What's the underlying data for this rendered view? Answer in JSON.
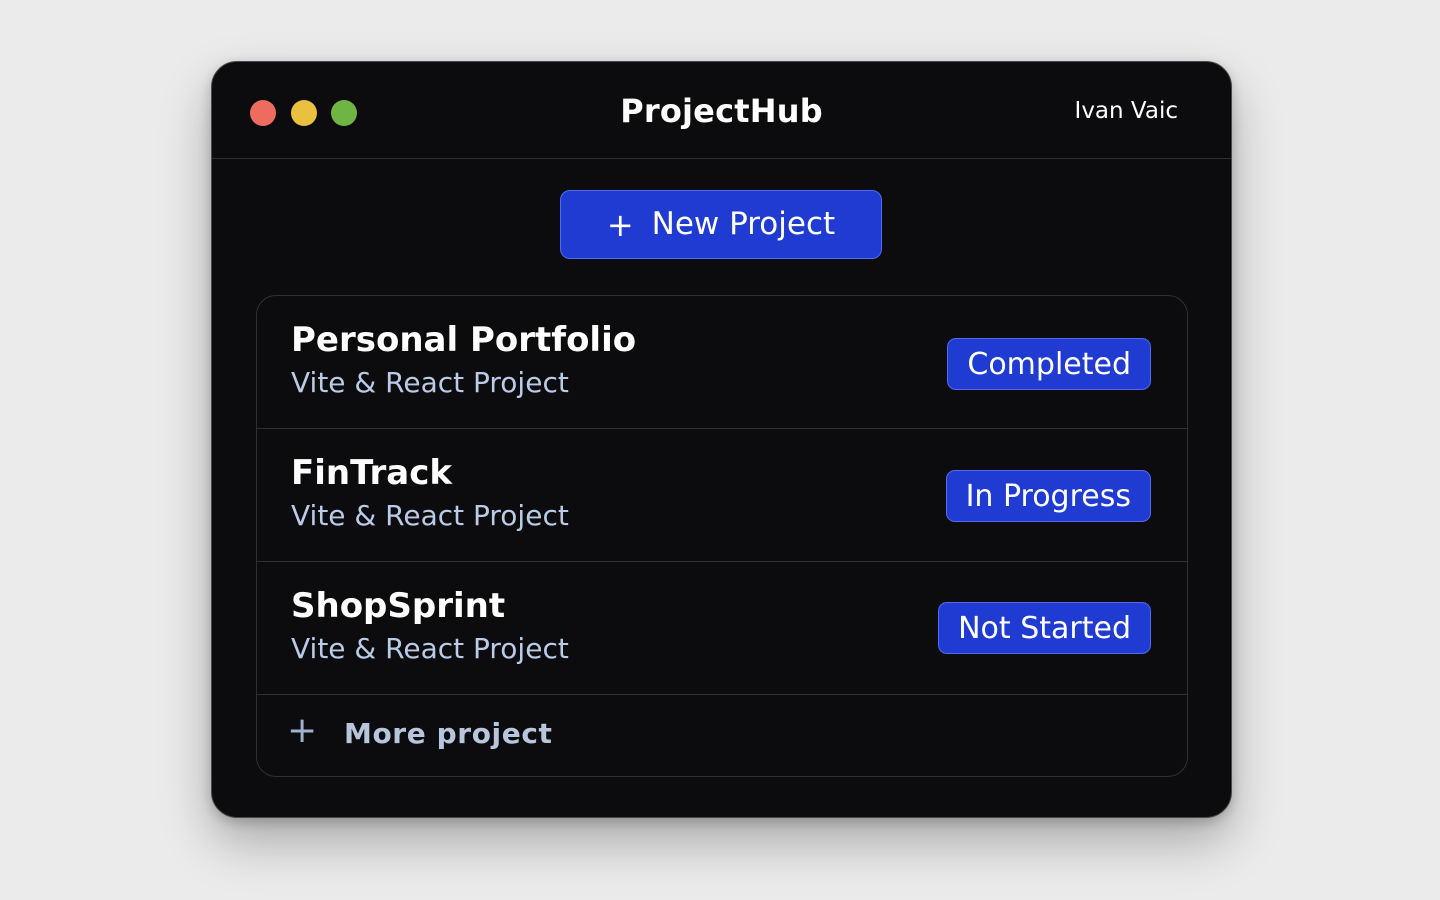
{
  "window": {
    "title": "ProjectHub",
    "user": "Ivan Vaic",
    "controls": [
      {
        "name": "close",
        "color": "#ee6b60"
      },
      {
        "name": "minimize",
        "color": "#e9c13f"
      },
      {
        "name": "maximize",
        "color": "#6fb543"
      }
    ]
  },
  "toolbar": {
    "new_project_icon": "+",
    "new_project_label": "New Project"
  },
  "projects": [
    {
      "name": "Personal Portfolio",
      "subtitle": "Vite & React Project",
      "status": "Completed"
    },
    {
      "name": "FinTrack",
      "subtitle": "Vite & React Project",
      "status": "In Progress"
    },
    {
      "name": "ShopSprint",
      "subtitle": "Vite & React Project",
      "status": "Not Started"
    }
  ],
  "more": {
    "icon": "+",
    "label": "More project"
  },
  "colors": {
    "accent": "#1f3bd2",
    "background": "#0c0c0f",
    "subtitle": "#b9cbe6"
  }
}
